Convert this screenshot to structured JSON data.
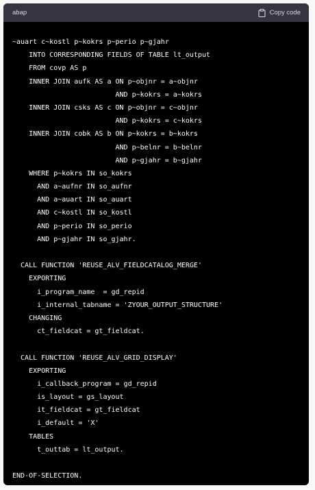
{
  "header": {
    "language": "abap",
    "copy_label": "Copy code"
  },
  "code_lines": [
    "~auart c~kostl p~kokrs p~perio p~gjahr",
    "    INTO CORRESPONDING FIELDS OF TABLE lt_output",
    "    FROM covp AS p",
    "    INNER JOIN aufk AS a ON p~objnr = a~objnr",
    "                         AND p~kokrs = a~kokrs",
    "    INNER JOIN csks AS c ON p~objnr = c~objnr",
    "                         AND p~kokrs = c~kokrs",
    "    INNER JOIN cobk AS b ON p~kokrs = b~kokrs",
    "                         AND p~belnr = b~belnr",
    "                         AND p~gjahr = b~gjahr",
    "    WHERE p~kokrs IN so_kokrs",
    "      AND a~aufnr IN so_aufnr",
    "      AND a~auart IN so_auart",
    "      AND c~kostl IN so_kostl",
    "      AND p~perio IN so_perio",
    "      AND p~gjahr IN so_gjahr.",
    "",
    "  CALL FUNCTION 'REUSE_ALV_FIELDCATALOG_MERGE'",
    "    EXPORTING",
    "      i_program_name  = gd_repid",
    "      i_internal_tabname = 'ZYOUR_OUTPUT_STRUCTURE'",
    "    CHANGING",
    "      ct_fieldcat = gt_fieldcat.",
    "",
    "  CALL FUNCTION 'REUSE_ALV_GRID_DISPLAY'",
    "    EXPORTING",
    "      i_callback_program = gd_repid",
    "      is_layout = gs_layout",
    "      it_fieldcat = gt_fieldcat",
    "      i_default = 'X'",
    "    TABLES",
    "      t_outtab = lt_output.",
    "",
    "END-OF-SELECTION."
  ]
}
